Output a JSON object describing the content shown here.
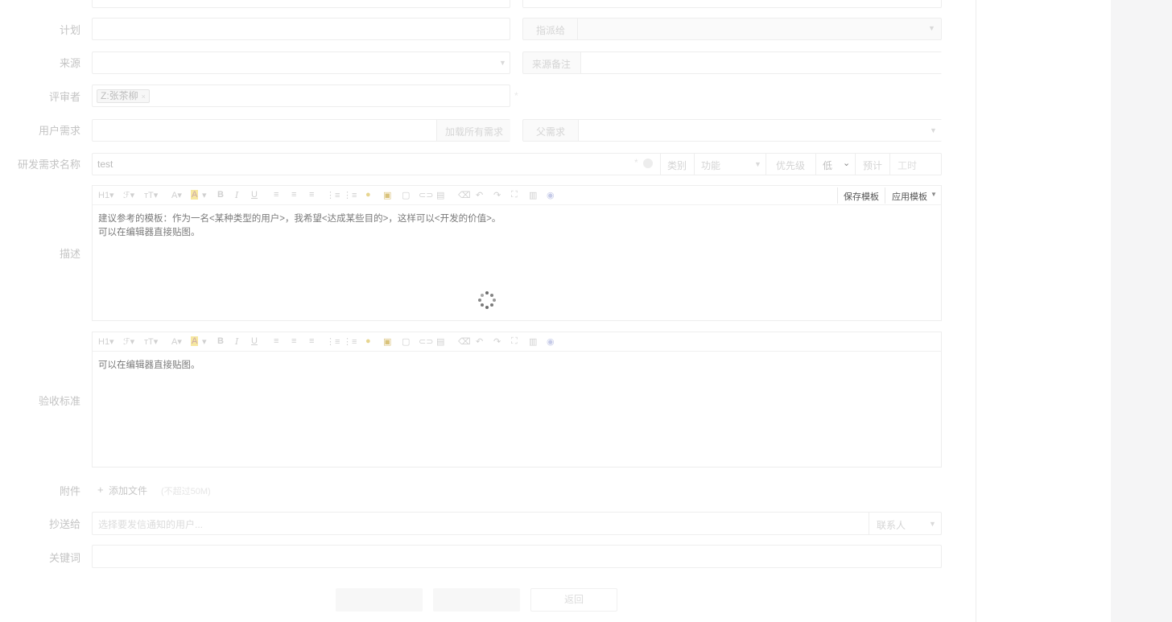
{
  "form": {
    "plan_label": "计划",
    "assign_label": "指派给",
    "source_label": "来源",
    "source_note_label": "来源备注",
    "reviewer_label": "评审者",
    "reviewer_tag": "Z:张茶柳",
    "reviewer_tag_remove": "×",
    "required_mark": "*",
    "user_story_label": "用户需求",
    "load_all_stories": "加载所有需求",
    "parent_story_label": "父需求",
    "story_name_label": "研发需求名称",
    "story_name_value": "test",
    "category_label": "类别",
    "category_value": "功能",
    "priority_label": "优先级",
    "priority_value": "低",
    "estimate_label": "预计",
    "hours_label": "工时",
    "description_label": "描述",
    "description_lines": [
      "建议参考的模板：作为一名<某种类型的用户>，我希望<达成某些目的>，这样可以<开发的价值>。",
      "可以在编辑器直接贴图。"
    ],
    "save_template": "保存模板",
    "apply_template": "应用模板",
    "verify_label": "验收标准",
    "verify_line": "可以在编辑器直接贴图。",
    "attachment_label": "附件",
    "add_file": "添加文件",
    "file_limit": "(不超过50M)",
    "cc_label": "抄送给",
    "cc_placeholder": "选择要发信通知的用户...",
    "contacts": "联系人",
    "keywords_label": "关键词",
    "back_button": "返回"
  },
  "toolbar": {
    "items": [
      "H1",
      "F",
      "TT",
      "A",
      "A",
      "B",
      "I",
      "U"
    ]
  },
  "colors": {
    "spinner": "#6d6d6d",
    "highlight": "#f4e27a",
    "side_panel": "#f5f5f6"
  }
}
